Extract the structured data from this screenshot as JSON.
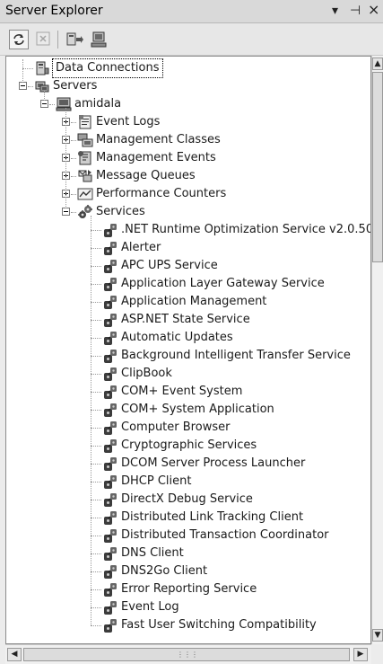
{
  "window": {
    "title": "Server Explorer",
    "controls": {
      "menu": "▾",
      "pin": "⊣",
      "close": "×"
    }
  },
  "toolbar": {
    "buttons": [
      {
        "name": "refresh-button",
        "icon": "refresh-icon"
      },
      {
        "name": "stop-refresh-button",
        "icon": "stop-icon"
      },
      {
        "name": "connect-to-database-button",
        "icon": "connect-database-icon"
      },
      {
        "name": "connect-to-server-button",
        "icon": "connect-server-icon"
      }
    ]
  },
  "tree": {
    "nodes": [
      {
        "name": "tree-node-data-connections",
        "label": "Data Connections",
        "level": 0,
        "toggle": "none",
        "icon": "data-connections-icon",
        "selected": true
      },
      {
        "name": "tree-node-servers",
        "label": "Servers",
        "level": 0,
        "toggle": "expanded",
        "icon": "servers-icon"
      },
      {
        "name": "tree-node-amidala",
        "label": "amidala",
        "level": 1,
        "toggle": "expanded",
        "icon": "computer-icon"
      },
      {
        "name": "tree-node-event-logs",
        "label": "Event Logs",
        "level": 2,
        "toggle": "collapsed",
        "icon": "event-logs-icon"
      },
      {
        "name": "tree-node-management-classes",
        "label": "Management Classes",
        "level": 2,
        "toggle": "collapsed",
        "icon": "management-classes-icon"
      },
      {
        "name": "tree-node-management-events",
        "label": "Management Events",
        "level": 2,
        "toggle": "collapsed",
        "icon": "management-events-icon"
      },
      {
        "name": "tree-node-message-queues",
        "label": "Message Queues",
        "level": 2,
        "toggle": "collapsed",
        "icon": "message-queues-icon"
      },
      {
        "name": "tree-node-performance-counters",
        "label": "Performance Counters",
        "level": 2,
        "toggle": "collapsed",
        "icon": "performance-counters-icon"
      },
      {
        "name": "tree-node-services",
        "label": "Services",
        "level": 2,
        "toggle": "expanded",
        "icon": "services-icon"
      },
      {
        "name": "service-item",
        "label": ".NET Runtime Optimization Service v2.0.50",
        "level": 3,
        "toggle": "none",
        "icon": "service-icon"
      },
      {
        "name": "service-item",
        "label": "Alerter",
        "level": 3,
        "toggle": "none",
        "icon": "service-icon"
      },
      {
        "name": "service-item",
        "label": "APC UPS Service",
        "level": 3,
        "toggle": "none",
        "icon": "service-icon"
      },
      {
        "name": "service-item",
        "label": "Application Layer Gateway Service",
        "level": 3,
        "toggle": "none",
        "icon": "service-icon"
      },
      {
        "name": "service-item",
        "label": "Application Management",
        "level": 3,
        "toggle": "none",
        "icon": "service-icon"
      },
      {
        "name": "service-item",
        "label": "ASP.NET State Service",
        "level": 3,
        "toggle": "none",
        "icon": "service-icon"
      },
      {
        "name": "service-item",
        "label": "Automatic Updates",
        "level": 3,
        "toggle": "none",
        "icon": "service-icon"
      },
      {
        "name": "service-item",
        "label": "Background Intelligent Transfer Service",
        "level": 3,
        "toggle": "none",
        "icon": "service-icon"
      },
      {
        "name": "service-item",
        "label": "ClipBook",
        "level": 3,
        "toggle": "none",
        "icon": "service-icon"
      },
      {
        "name": "service-item",
        "label": "COM+ Event System",
        "level": 3,
        "toggle": "none",
        "icon": "service-icon"
      },
      {
        "name": "service-item",
        "label": "COM+ System Application",
        "level": 3,
        "toggle": "none",
        "icon": "service-icon"
      },
      {
        "name": "service-item",
        "label": "Computer Browser",
        "level": 3,
        "toggle": "none",
        "icon": "service-icon"
      },
      {
        "name": "service-item",
        "label": "Cryptographic Services",
        "level": 3,
        "toggle": "none",
        "icon": "service-icon"
      },
      {
        "name": "service-item",
        "label": "DCOM Server Process Launcher",
        "level": 3,
        "toggle": "none",
        "icon": "service-icon"
      },
      {
        "name": "service-item",
        "label": "DHCP Client",
        "level": 3,
        "toggle": "none",
        "icon": "service-icon"
      },
      {
        "name": "service-item",
        "label": "DirectX Debug Service",
        "level": 3,
        "toggle": "none",
        "icon": "service-icon"
      },
      {
        "name": "service-item",
        "label": "Distributed Link Tracking Client",
        "level": 3,
        "toggle": "none",
        "icon": "service-icon"
      },
      {
        "name": "service-item",
        "label": "Distributed Transaction Coordinator",
        "level": 3,
        "toggle": "none",
        "icon": "service-icon"
      },
      {
        "name": "service-item",
        "label": "DNS Client",
        "level": 3,
        "toggle": "none",
        "icon": "service-icon"
      },
      {
        "name": "service-item",
        "label": "DNS2Go Client",
        "level": 3,
        "toggle": "none",
        "icon": "service-icon"
      },
      {
        "name": "service-item",
        "label": "Error Reporting Service",
        "level": 3,
        "toggle": "none",
        "icon": "service-icon"
      },
      {
        "name": "service-item",
        "label": "Event Log",
        "level": 3,
        "toggle": "none",
        "icon": "service-icon"
      },
      {
        "name": "service-item",
        "label": "Fast User Switching Compatibility",
        "level": 3,
        "toggle": "none",
        "icon": "service-icon"
      }
    ]
  },
  "scrollbars": {
    "vertical": {
      "up": "▲",
      "down": "▼"
    },
    "horizontal": {
      "left": "◀",
      "right": "▶",
      "grip": "⋮⋮⋮"
    }
  }
}
